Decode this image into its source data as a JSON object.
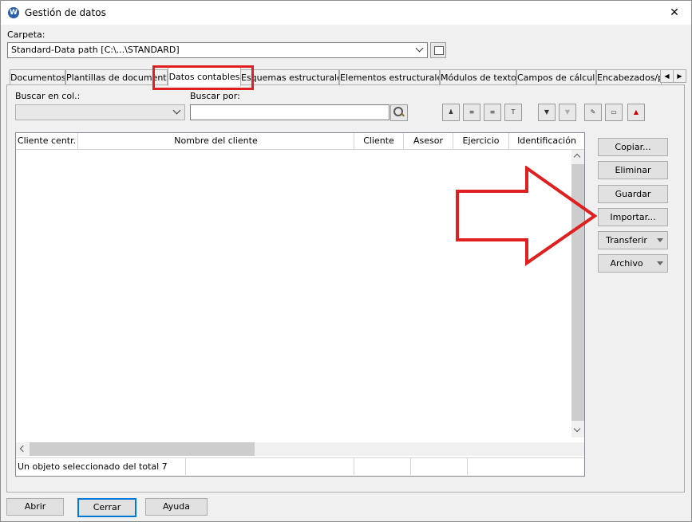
{
  "window": {
    "title": "Gestión de datos",
    "app_icon_letter": "W"
  },
  "folder": {
    "label": "Carpeta:",
    "value": "Standard-Data path [C:\\...\\STANDARD]"
  },
  "tabs": [
    {
      "label": "Documentos"
    },
    {
      "label": "Plantillas de documentos"
    },
    {
      "label": "Datos contables",
      "active": true
    },
    {
      "label": "Esquemas estructurales"
    },
    {
      "label": "Elementos estructurales"
    },
    {
      "label": "Módulos de texto"
    },
    {
      "label": "Campos de cálculo"
    },
    {
      "label": "Encabezados/p"
    }
  ],
  "search": {
    "column_label": "Buscar en col.:",
    "column_value": "",
    "query_label": "Buscar por:",
    "query_value": ""
  },
  "table": {
    "columns": [
      "Cliente centr.",
      "Nombre del cliente",
      "Cliente",
      "Asesor",
      "Ejercicio",
      "Identificación"
    ],
    "rows": []
  },
  "status": {
    "text": "Un objeto seleccionado del total 7"
  },
  "side_buttons": {
    "copy": "Copiar...",
    "delete": "Eliminar",
    "save": "Guardar",
    "import": "Importar...",
    "transfer": "Transferir",
    "file": "Archivo"
  },
  "bottom_buttons": {
    "open": "Abrir",
    "close": "Cerrar",
    "help": "Ayuda"
  },
  "colors": {
    "highlight": "#e02020",
    "accent": "#0078d7"
  }
}
